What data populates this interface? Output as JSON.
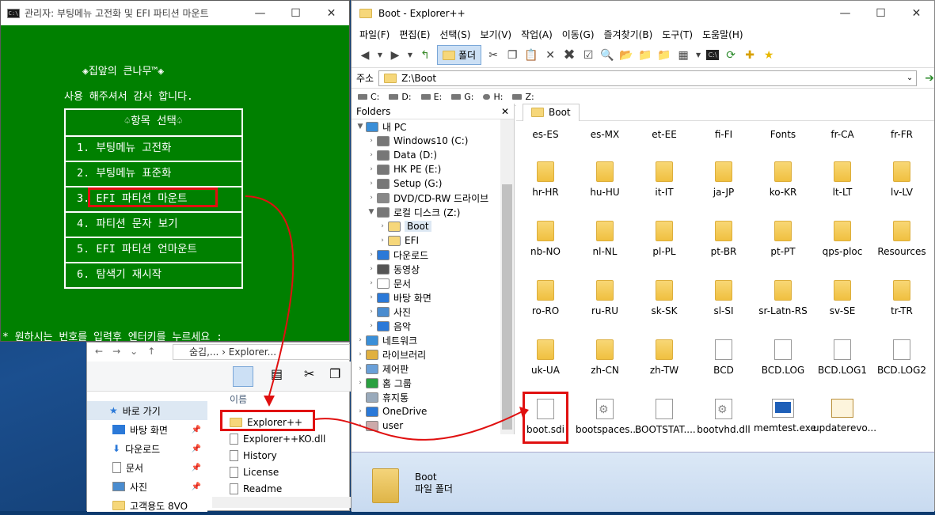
{
  "cmd": {
    "title": "관리자:  부팅메뉴 고전화 및 EFI 파티션 마운트",
    "banner": "◈집앞의 큰나무™◈",
    "thanks": "사용 해주셔서 감사 합니다.",
    "menu_header": "♤항목  선택♤",
    "menu_items": [
      "1. 부팅메뉴 고전화",
      "2. 부팅메뉴 표준화",
      "3. EFI 파티션 마운트",
      "4. 파티션 문자 보기",
      "5. EFI 파티션 언마운트",
      "6. 탐색기 재시작"
    ],
    "prompt": "* 원하시는 번호를 입력후 엔터키를 누르세요 :"
  },
  "small_explorer": {
    "breadcrumb": "숨김,...  ›  Explorer...",
    "column_name": "이름",
    "quick_access": "바로 가기",
    "nav_items": [
      {
        "label": "바탕 화면"
      },
      {
        "label": "다운로드"
      },
      {
        "label": "문서"
      },
      {
        "label": "사진"
      },
      {
        "label": "고객용도 8VO"
      }
    ],
    "files": [
      "Explorer++",
      "Explorer++KO.dll",
      "History",
      "License",
      "Readme"
    ]
  },
  "explorer": {
    "title": "Boot - Explorer++",
    "menu": [
      "파일(F)",
      "편집(E)",
      "선택(S)",
      "보기(V)",
      "작업(A)",
      "이동(G)",
      "즐겨찾기(B)",
      "도구(T)",
      "도움말(H)"
    ],
    "folders_button": "폴더",
    "address_label": "주소",
    "address": "Z:\\Boot",
    "drives": [
      "C:",
      "D:",
      "E:",
      "G:",
      "H:",
      "Z:"
    ],
    "folders_title": "Folders",
    "tree": [
      {
        "label": "내 PC",
        "icon": "pc",
        "level": 0,
        "exp": "▼"
      },
      {
        "label": "Windows10 (C:)",
        "icon": "drive",
        "level": 1,
        "exp": "›"
      },
      {
        "label": "Data (D:)",
        "icon": "drive",
        "level": 1,
        "exp": "›"
      },
      {
        "label": "HK PE (E:)",
        "icon": "drive",
        "level": 1,
        "exp": "›"
      },
      {
        "label": "Setup (G:)",
        "icon": "drive",
        "level": 1,
        "exp": "›"
      },
      {
        "label": "DVD/CD-RW 드라이브",
        "icon": "dvd",
        "level": 1,
        "exp": "›"
      },
      {
        "label": "로컬 디스크 (Z:)",
        "icon": "drive",
        "level": 1,
        "exp": "▼"
      },
      {
        "label": "Boot",
        "icon": "folder",
        "level": 2,
        "exp": "›",
        "selected": true
      },
      {
        "label": "EFI",
        "icon": "folder",
        "level": 2,
        "exp": "›"
      },
      {
        "label": "다운로드",
        "icon": "download",
        "level": 1,
        "exp": "›"
      },
      {
        "label": "동영상",
        "icon": "video",
        "level": 1,
        "exp": "›"
      },
      {
        "label": "문서",
        "icon": "doc",
        "level": 1,
        "exp": "›"
      },
      {
        "label": "바탕 화면",
        "icon": "desktop",
        "level": 1,
        "exp": "›"
      },
      {
        "label": "사진",
        "icon": "picture",
        "level": 1,
        "exp": "›"
      },
      {
        "label": "음악",
        "icon": "music",
        "level": 1,
        "exp": "›"
      },
      {
        "label": "네트워크",
        "icon": "network",
        "level": 0,
        "exp": "›"
      },
      {
        "label": "라이브러리",
        "icon": "library",
        "level": 0,
        "exp": "›"
      },
      {
        "label": "제어판",
        "icon": "control",
        "level": 0,
        "exp": "›"
      },
      {
        "label": "홈 그룹",
        "icon": "homegroup",
        "level": 0,
        "exp": "›"
      },
      {
        "label": "휴지통",
        "icon": "recycle",
        "level": 0,
        "exp": ""
      },
      {
        "label": "OneDrive",
        "icon": "onedrive",
        "level": 0,
        "exp": "›"
      },
      {
        "label": "user",
        "icon": "user",
        "level": 0,
        "exp": "›"
      }
    ],
    "tab": "Boot",
    "files": [
      {
        "name": "es-ES",
        "type": "folder"
      },
      {
        "name": "es-MX",
        "type": "folder"
      },
      {
        "name": "et-EE",
        "type": "folder"
      },
      {
        "name": "fi-FI",
        "type": "folder"
      },
      {
        "name": "Fonts",
        "type": "folder"
      },
      {
        "name": "fr-CA",
        "type": "folder"
      },
      {
        "name": "fr-FR",
        "type": "folder"
      },
      {
        "name": "hr-HR",
        "type": "folder"
      },
      {
        "name": "hu-HU",
        "type": "folder"
      },
      {
        "name": "it-IT",
        "type": "folder"
      },
      {
        "name": "ja-JP",
        "type": "folder"
      },
      {
        "name": "ko-KR",
        "type": "folder"
      },
      {
        "name": "lt-LT",
        "type": "folder"
      },
      {
        "name": "lv-LV",
        "type": "folder"
      },
      {
        "name": "nb-NO",
        "type": "folder"
      },
      {
        "name": "nl-NL",
        "type": "folder"
      },
      {
        "name": "pl-PL",
        "type": "folder"
      },
      {
        "name": "pt-BR",
        "type": "folder"
      },
      {
        "name": "pt-PT",
        "type": "folder"
      },
      {
        "name": "qps-ploc",
        "type": "folder"
      },
      {
        "name": "Resources",
        "type": "folder"
      },
      {
        "name": "ro-RO",
        "type": "folder"
      },
      {
        "name": "ru-RU",
        "type": "folder"
      },
      {
        "name": "sk-SK",
        "type": "folder"
      },
      {
        "name": "sl-SI",
        "type": "folder"
      },
      {
        "name": "sr-Latn-RS",
        "type": "folder"
      },
      {
        "name": "sv-SE",
        "type": "folder"
      },
      {
        "name": "tr-TR",
        "type": "folder"
      },
      {
        "name": "uk-UA",
        "type": "folder"
      },
      {
        "name": "zh-CN",
        "type": "folder"
      },
      {
        "name": "zh-TW",
        "type": "folder"
      },
      {
        "name": "BCD",
        "type": "file"
      },
      {
        "name": "BCD.LOG",
        "type": "file"
      },
      {
        "name": "BCD.LOG1",
        "type": "file"
      },
      {
        "name": "BCD.LOG2",
        "type": "file"
      },
      {
        "name": "boot.sdi",
        "type": "file"
      },
      {
        "name": "bootspaces...",
        "type": "gear"
      },
      {
        "name": "BOOTSTAT....",
        "type": "file"
      },
      {
        "name": "bootvhd.dll",
        "type": "gear"
      },
      {
        "name": "memtest.exe",
        "type": "exe"
      },
      {
        "name": "updaterevo...",
        "type": "cert"
      }
    ],
    "status_name": "Boot",
    "status_type": "파일 폴더"
  },
  "colors": {
    "cmd_bg": "#008000",
    "highlight": "#e01010"
  }
}
